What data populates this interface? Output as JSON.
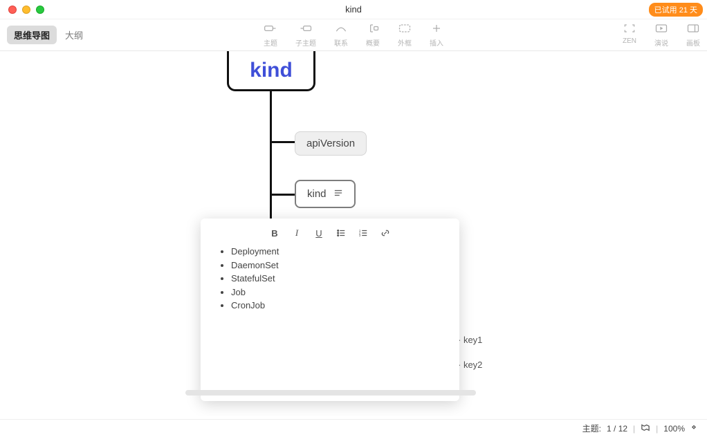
{
  "window": {
    "title": "kind",
    "trial_badge": "已试用 21 天"
  },
  "view_toggle": {
    "mindmap": "思维导图",
    "outline": "大纲"
  },
  "toolbar": {
    "topic": "主题",
    "subtopic": "子主题",
    "relationship": "联系",
    "summary": "概要",
    "boundary": "外框",
    "insert": "插入",
    "zen": "ZEN",
    "present": "演说",
    "panel": "画板"
  },
  "mindmap": {
    "root": "kind",
    "child_api": "apiVersion",
    "child_kind": "kind",
    "peek_key1": "· key1",
    "peek_key2": "· key2"
  },
  "note": {
    "items": [
      "Deployment",
      "DaemonSet",
      "StatefulSet",
      "Job",
      "CronJob"
    ]
  },
  "status": {
    "topic_label": "主题:",
    "topic_count": "1 / 12",
    "zoom": "100%"
  }
}
